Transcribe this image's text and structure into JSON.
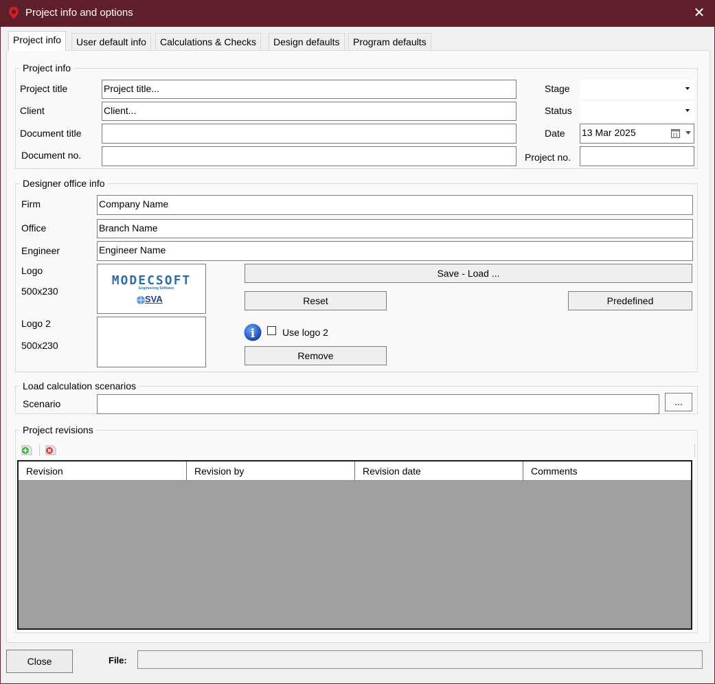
{
  "window": {
    "title": "Project info and options",
    "close_glyph": "✕"
  },
  "tabs": [
    {
      "label": "Project info"
    },
    {
      "label": "User default info"
    },
    {
      "label": "Calculations & Checks"
    },
    {
      "label": "Design defaults"
    },
    {
      "label": "Program defaults"
    }
  ],
  "project_info": {
    "legend": "Project info",
    "project_title_label": "Project title",
    "project_title_value": "Project title...",
    "client_label": "Client",
    "client_value": "Client...",
    "document_title_label": "Document title",
    "document_title_value": "",
    "document_no_label": "Document no.",
    "document_no_value": "",
    "stage_label": "Stage",
    "stage_value": "",
    "status_label": "Status",
    "status_value": "",
    "date_label": "Date",
    "date_value": "13 Mar 2025",
    "project_no_label": "Project no.",
    "project_no_value": ""
  },
  "designer_office": {
    "legend": "Designer office info",
    "firm_label": "Firm",
    "firm_value": "Company Name",
    "office_label": "Office",
    "office_value": "Branch Name",
    "engineer_label": "Engineer",
    "engineer_value": "Engineer Name",
    "logo_label": "Logo",
    "logo_size": "500x230",
    "logo_text": "MODECSOFT",
    "logo_subtext": "Engineering Software",
    "logo_mark": "SVA",
    "logo2_label": "Logo 2",
    "logo2_size": "500x230",
    "save_load_label": "Save - Load ...",
    "reset_label": "Reset",
    "predefined_label": "Predefined",
    "use_logo2_label": "Use logo 2",
    "remove_label": "Remove",
    "info_glyph": "i"
  },
  "load_calc": {
    "legend": "Load calculation scenarios",
    "scenario_label": "Scenario",
    "scenario_value": "",
    "browse_label": "..."
  },
  "revisions": {
    "legend": "Project revisions",
    "columns": [
      "Revision",
      "Revision by",
      "Revision date",
      "Comments"
    ]
  },
  "footer": {
    "close_label": "Close",
    "file_label": "File:",
    "file_value": ""
  },
  "colors": {
    "titlebar": "#5e1f2a",
    "logo_blue": "#2e6ea6",
    "info_blue": "#1f5fbf"
  },
  "icons": [
    "app-icon",
    "close-icon",
    "calendar-icon",
    "info-icon",
    "add-revision-icon",
    "delete-revision-icon",
    "dropdown-arrow-icon"
  ]
}
